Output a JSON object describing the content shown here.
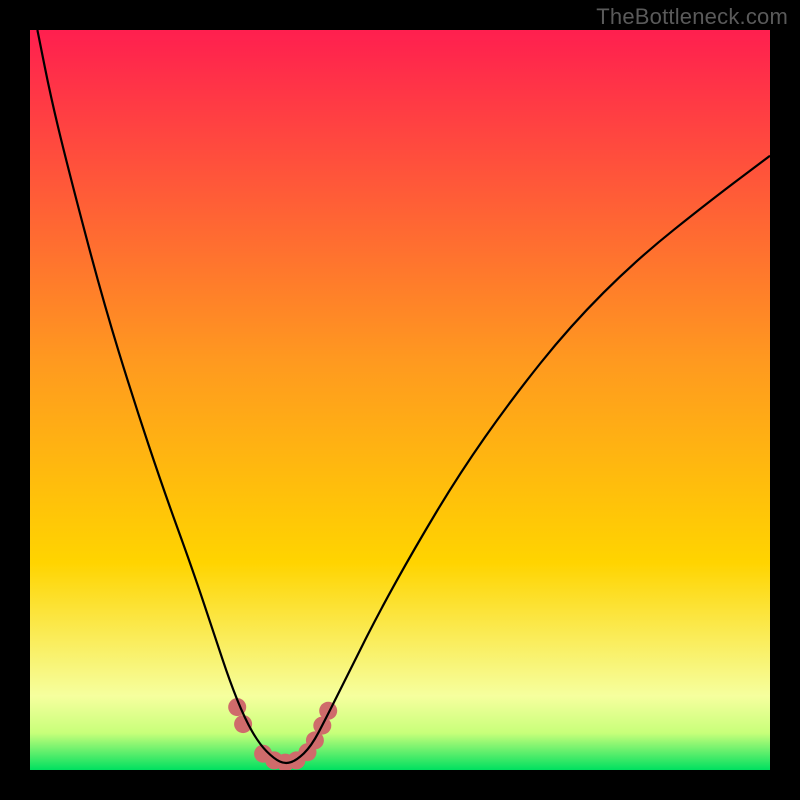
{
  "watermark": "TheBottleneck.com",
  "chart_data": {
    "type": "line",
    "title": "",
    "xlabel": "",
    "ylabel": "",
    "xlim": [
      0,
      100
    ],
    "ylim": [
      0,
      100
    ],
    "grid": false,
    "legend": false,
    "annotations": [],
    "gradient": {
      "top_color": "#ff1f4f",
      "mid_color": "#ffd400",
      "green_band_top": "#f6ff9e",
      "green_band_bottom": "#00e060"
    },
    "series": [
      {
        "name": "bottleneck-curve",
        "x": [
          1,
          3,
          6,
          10,
          14,
          18,
          22,
          25,
          27,
          29,
          31,
          33,
          34.5,
          36,
          38,
          40,
          43,
          47,
          52,
          58,
          65,
          73,
          82,
          92,
          100
        ],
        "y": [
          100,
          90,
          78,
          63,
          50,
          38,
          27,
          18,
          12,
          7,
          3.5,
          1.5,
          0.8,
          1.3,
          3.2,
          7,
          13,
          21,
          30,
          40,
          50,
          60,
          69,
          77,
          83
        ],
        "stroke": "#000000",
        "stroke_width": 2.2
      }
    ],
    "markers": {
      "name": "highlight-band",
      "points": [
        {
          "x": 28.0,
          "y": 8.5
        },
        {
          "x": 28.8,
          "y": 6.2
        },
        {
          "x": 31.5,
          "y": 2.2
        },
        {
          "x": 33.0,
          "y": 1.3
        },
        {
          "x": 34.5,
          "y": 1.0
        },
        {
          "x": 36.0,
          "y": 1.3
        },
        {
          "x": 37.5,
          "y": 2.4
        },
        {
          "x": 38.5,
          "y": 4.0
        },
        {
          "x": 39.5,
          "y": 6.0
        },
        {
          "x": 40.3,
          "y": 8.0
        }
      ],
      "radius": 9,
      "fill": "#cf6b6b"
    }
  }
}
